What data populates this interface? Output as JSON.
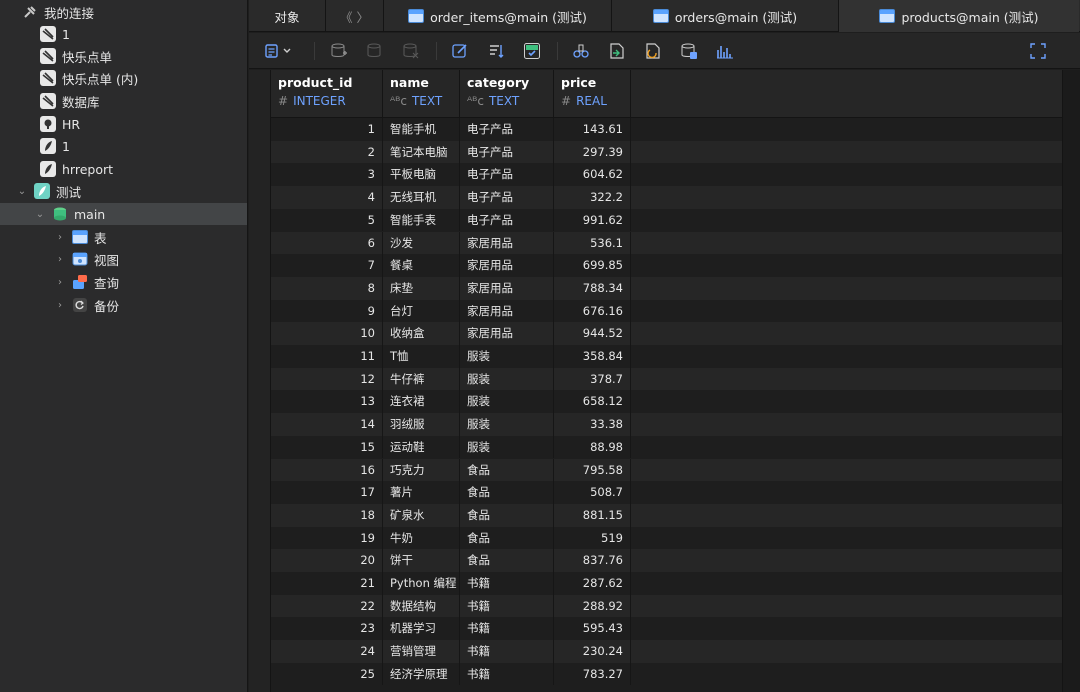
{
  "sidebar": {
    "items": [
      {
        "label": "我的连接",
        "icon": "connections-icon"
      },
      {
        "label": "1",
        "icon": "mysql-icon"
      },
      {
        "label": "快乐点单",
        "icon": "mysql-icon"
      },
      {
        "label": "快乐点单 (内)",
        "icon": "mysql-icon"
      },
      {
        "label": "数据库",
        "icon": "mysql-icon"
      },
      {
        "label": "HR",
        "icon": "postgres-icon"
      },
      {
        "label": "1",
        "icon": "sqlite-icon"
      },
      {
        "label": "hrreport",
        "icon": "sqlite-icon"
      },
      {
        "label": "测试",
        "icon": "sqlite-icon"
      },
      {
        "label": "main",
        "icon": "database-icon"
      },
      {
        "label": "表",
        "icon": "tables-icon"
      },
      {
        "label": "视图",
        "icon": "views-icon"
      },
      {
        "label": "查询",
        "icon": "queries-icon"
      },
      {
        "label": "备份",
        "icon": "backup-icon"
      }
    ]
  },
  "tabs": {
    "objects": "对象",
    "nav": "《 〉",
    "order_items": "order_items@main (测试)",
    "orders": "orders@main (测试)",
    "products": "products@main (测试)"
  },
  "columns": [
    {
      "name": "product_id",
      "type": "INTEGER",
      "sym": "#"
    },
    {
      "name": "name",
      "type": "TEXT",
      "sym": "ᴬᴮc"
    },
    {
      "name": "category",
      "type": "TEXT",
      "sym": "ᴬᴮc"
    },
    {
      "name": "price",
      "type": "REAL",
      "sym": "#"
    }
  ],
  "rows": [
    [
      "1",
      "智能手机",
      "电子产品",
      "143.61"
    ],
    [
      "2",
      "笔记本电脑",
      "电子产品",
      "297.39"
    ],
    [
      "3",
      "平板电脑",
      "电子产品",
      "604.62"
    ],
    [
      "4",
      "无线耳机",
      "电子产品",
      "322.2"
    ],
    [
      "5",
      "智能手表",
      "电子产品",
      "991.62"
    ],
    [
      "6",
      "沙发",
      "家居用品",
      "536.1"
    ],
    [
      "7",
      "餐桌",
      "家居用品",
      "699.85"
    ],
    [
      "8",
      "床垫",
      "家居用品",
      "788.34"
    ],
    [
      "9",
      "台灯",
      "家居用品",
      "676.16"
    ],
    [
      "10",
      "收纳盒",
      "家居用品",
      "944.52"
    ],
    [
      "11",
      "T恤",
      "服装",
      "358.84"
    ],
    [
      "12",
      "牛仔裤",
      "服装",
      "378.7"
    ],
    [
      "13",
      "连衣裙",
      "服装",
      "658.12"
    ],
    [
      "14",
      "羽绒服",
      "服装",
      "33.38"
    ],
    [
      "15",
      "运动鞋",
      "服装",
      "88.98"
    ],
    [
      "16",
      "巧克力",
      "食品",
      "795.58"
    ],
    [
      "17",
      "薯片",
      "食品",
      "508.7"
    ],
    [
      "18",
      "矿泉水",
      "食品",
      "881.15"
    ],
    [
      "19",
      "牛奶",
      "食品",
      "519"
    ],
    [
      "20",
      "饼干",
      "食品",
      "837.76"
    ],
    [
      "21",
      "Python 编程",
      "书籍",
      "287.62"
    ],
    [
      "22",
      "数据结构",
      "书籍",
      "288.92"
    ],
    [
      "23",
      "机器学习",
      "书籍",
      "595.43"
    ],
    [
      "24",
      "营销管理",
      "书籍",
      "230.24"
    ],
    [
      "25",
      "经济学原理",
      "书籍",
      "783.27"
    ]
  ],
  "colors": {
    "type_blue": "#6ea2ff",
    "accent_green": "#3fbf7f"
  }
}
